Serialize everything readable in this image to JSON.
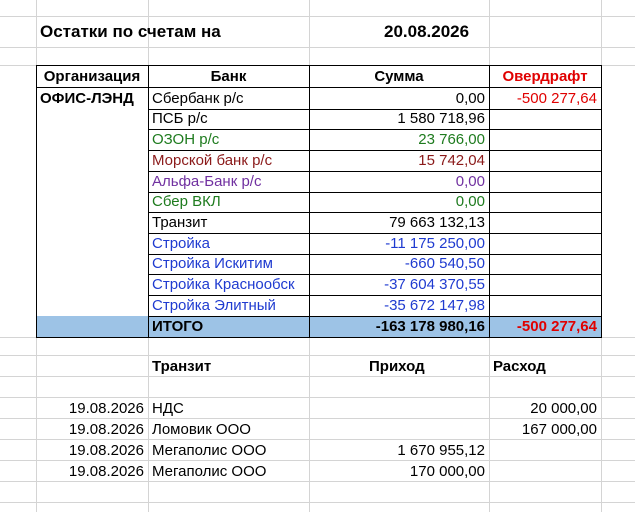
{
  "header": {
    "title": "Остатки по счетам на",
    "date": "20.08.2026"
  },
  "table": {
    "columns": {
      "org": "Организация",
      "bank": "Банк",
      "sum": "Сумма",
      "overdraft": "Овердрафт"
    },
    "org_name": "ОФИС-ЛЭНД",
    "rows": [
      {
        "bank": "Сбербанк р/с",
        "sum": "0,00",
        "overdraft": "-500 277,64",
        "bank_color": "#000000",
        "sum_color": "#000000"
      },
      {
        "bank": "ПСБ р/с",
        "sum": "1 580 718,96",
        "overdraft": "",
        "bank_color": "#000000",
        "sum_color": "#000000"
      },
      {
        "bank": "ОЗОН р/с",
        "sum": "23 766,00",
        "overdraft": "",
        "bank_color": "#1e7b1e",
        "sum_color": "#1e7b1e"
      },
      {
        "bank": "Морской банк р/с",
        "sum": "15 742,04",
        "overdraft": "",
        "bank_color": "#8b1a1a",
        "sum_color": "#8b1a1a"
      },
      {
        "bank": "Альфа-Банк р/с",
        "sum": "0,00",
        "overdraft": "",
        "bank_color": "#7030a0",
        "sum_color": "#7030a0"
      },
      {
        "bank": "Сбер ВКЛ",
        "sum": "0,00",
        "overdraft": "",
        "bank_color": "#1e7b1e",
        "sum_color": "#1e7b1e"
      },
      {
        "bank": "Транзит",
        "sum": "79 663 132,13",
        "overdraft": "",
        "bank_color": "#000000",
        "sum_color": "#000000"
      },
      {
        "bank": "Стройка",
        "sum": "-11 175 250,00",
        "overdraft": "",
        "bank_color": "#1f3bd0",
        "sum_color": "#1f3bd0"
      },
      {
        "bank": "Стройка Искитим",
        "sum": "-660 540,50",
        "overdraft": "",
        "bank_color": "#1f3bd0",
        "sum_color": "#1f3bd0"
      },
      {
        "bank": "Стройка Краснообск",
        "sum": "-37 604 370,55",
        "overdraft": "",
        "bank_color": "#1f3bd0",
        "sum_color": "#1f3bd0"
      },
      {
        "bank": "Стройка Элитный",
        "sum": "-35 672 147,98",
        "overdraft": "",
        "bank_color": "#1f3bd0",
        "sum_color": "#1f3bd0"
      }
    ],
    "total": {
      "label": "ИТОГО",
      "sum": "-163 178 980,16",
      "overdraft": "-500 277,64"
    }
  },
  "transit": {
    "columns": {
      "name": "Транзит",
      "income": "Приход",
      "expense": "Расход"
    },
    "rows": [
      {
        "date": "19.08.2026",
        "name": "НДС",
        "income": "",
        "expense": "20 000,00"
      },
      {
        "date": "19.08.2026",
        "name": "Ломовик ООО",
        "income": "",
        "expense": "167 000,00"
      },
      {
        "date": "19.08.2026",
        "name": "Мегаполис ООО",
        "income": "1 670 955,12",
        "expense": ""
      },
      {
        "date": "19.08.2026",
        "name": "Мегаполис ООО",
        "income": "170 000,00",
        "expense": ""
      }
    ]
  },
  "colors": {
    "overdraft": "#e00000",
    "total_bg": "#9dc3e6",
    "grid": "#d4d4d4"
  }
}
